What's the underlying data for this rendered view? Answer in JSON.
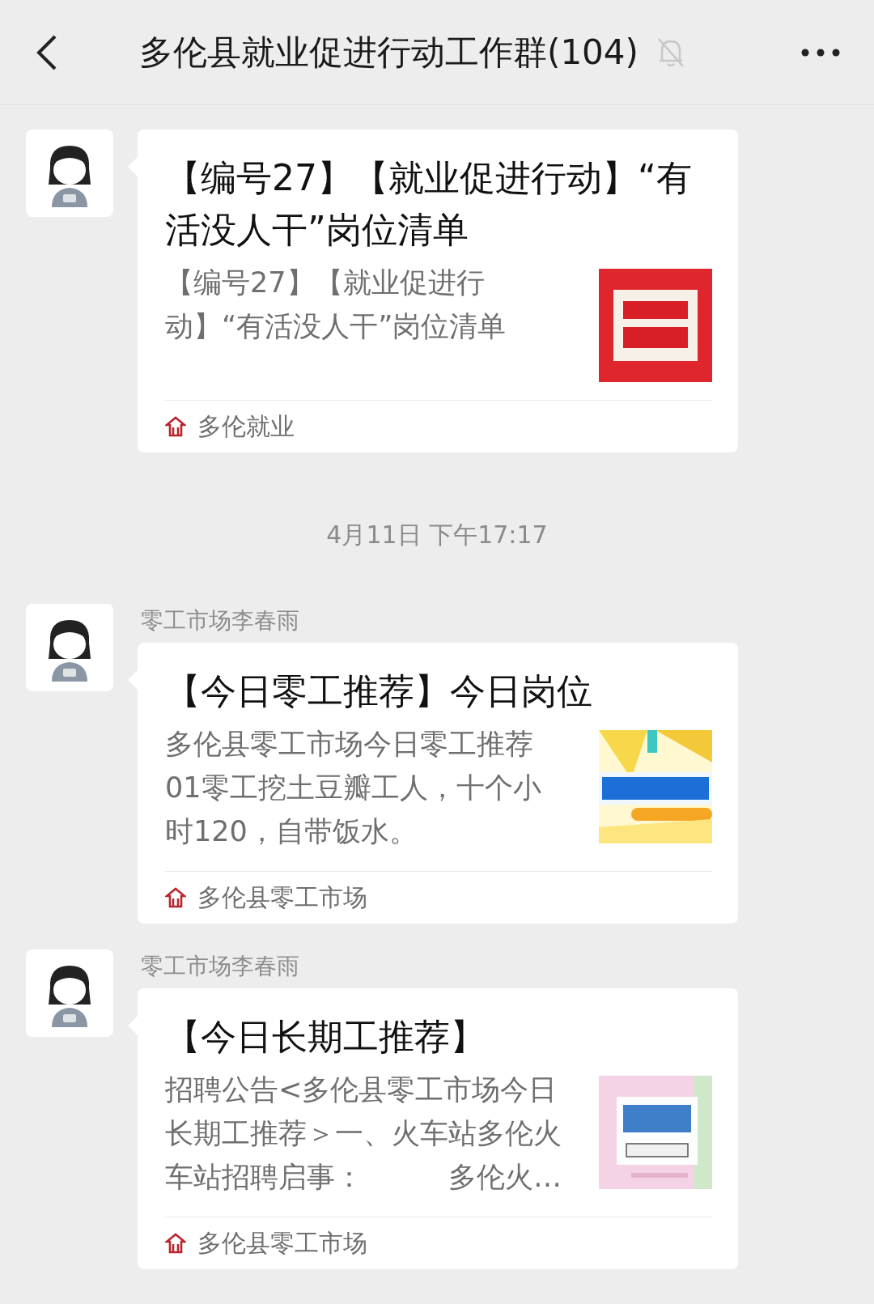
{
  "header": {
    "title": "多伦县就业促进行动工作群(104)",
    "muted": true
  },
  "messages": [
    {
      "kind": "article",
      "title": "【编号27】【就业促进行动】“有活没人干”岗位清单",
      "description": "【编号27】【就业促进行动】“有活没人干”岗位清单",
      "source": "多伦就业"
    },
    {
      "kind": "time",
      "text": "4月11日 下午17:17"
    },
    {
      "kind": "article",
      "sender": "零工市场李春雨",
      "title": "【今日零工推荐】今日岗位",
      "description": "多伦县零工市场今日零工推荐01零工挖土豆瓣工人，十个小时120，自带饭水。",
      "source": "多伦县零工市场"
    },
    {
      "kind": "article",
      "sender": "零工市场李春雨",
      "title": "【今日长期工推荐】",
      "description": "招聘公告<多伦县零工市场今日长期工推荐＞一、火车站多伦火车站招聘启事：　　　多伦火…",
      "source": "多伦县零工市场"
    }
  ]
}
